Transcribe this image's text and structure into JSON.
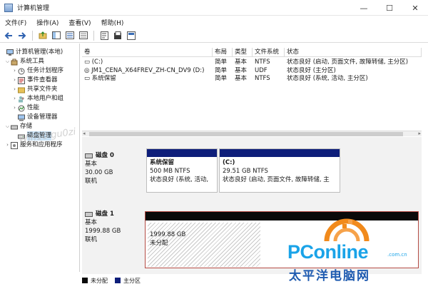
{
  "window": {
    "title": "计算机管理",
    "controls": [
      "—",
      "☐",
      "✕"
    ]
  },
  "menubar": {
    "items": [
      "文件(F)",
      "操作(A)",
      "查看(V)",
      "帮助(H)"
    ]
  },
  "toolbar": {
    "icons": [
      "back-arrow-icon",
      "forward-arrow-icon",
      "up-folder-icon",
      "show-tree-icon",
      "help-book-icon",
      "properties-icon",
      "view-icon",
      "refresh-icon"
    ]
  },
  "tree": {
    "root": "计算机管理(本地)",
    "system_tools": "系统工具",
    "task_scheduler": "任务计划程序",
    "event_viewer": "事件查看器",
    "shared_folders": "共享文件夹",
    "local_users": "本地用户和组",
    "performance": "性能",
    "device_manager": "设备管理器",
    "storage": "存储",
    "disk_management": "磁盘管理",
    "services_apps": "服务和应用程序"
  },
  "volumes": {
    "headers": [
      "卷",
      "布局",
      "类型",
      "文件系统",
      "状态"
    ],
    "rows": [
      {
        "volume": "(C:)",
        "layout": "简单",
        "type": "基本",
        "fs": "NTFS",
        "status": "状态良好 (启动, 页面文件, 故障转储, 主分区)"
      },
      {
        "volume": "JM1_CENA_X64FREV_ZH-CN_DV9 (D:)",
        "layout": "简单",
        "type": "基本",
        "fs": "UDF",
        "status": "状态良好 (主分区)"
      },
      {
        "volume": "系统保留",
        "layout": "简单",
        "type": "基本",
        "fs": "NTFS",
        "status": "状态良好 (系统, 活动, 主分区)"
      }
    ]
  },
  "disks": {
    "disk0": {
      "name": "磁盘 0",
      "type": "基本",
      "size": "30.00 GB",
      "state": "联机",
      "partitions": [
        {
          "name": "系统保留",
          "size": "500 MB NTFS",
          "status": "状态良好 (系统, 活动,"
        },
        {
          "name": "(C:)",
          "size": "29.51 GB NTFS",
          "status": "状态良好 (启动, 页面文件, 故障转储, 主"
        }
      ]
    },
    "disk1": {
      "name": "磁盘 1",
      "type": "基本",
      "size": "1999.88 GB",
      "state": "联机",
      "unallocated_size": "1999.88 GB",
      "unallocated_label": "未分配"
    }
  },
  "legend": {
    "unallocated": "未分配",
    "primary": "主分区",
    "unallocated_color": "#0a0a0a",
    "primary_color": "#0e1e7a"
  },
  "watermark": {
    "brand": "PConline",
    "domain": ".com.cn",
    "cn": "太平洋电脑网",
    "faint": "Win10 gu0zi"
  }
}
